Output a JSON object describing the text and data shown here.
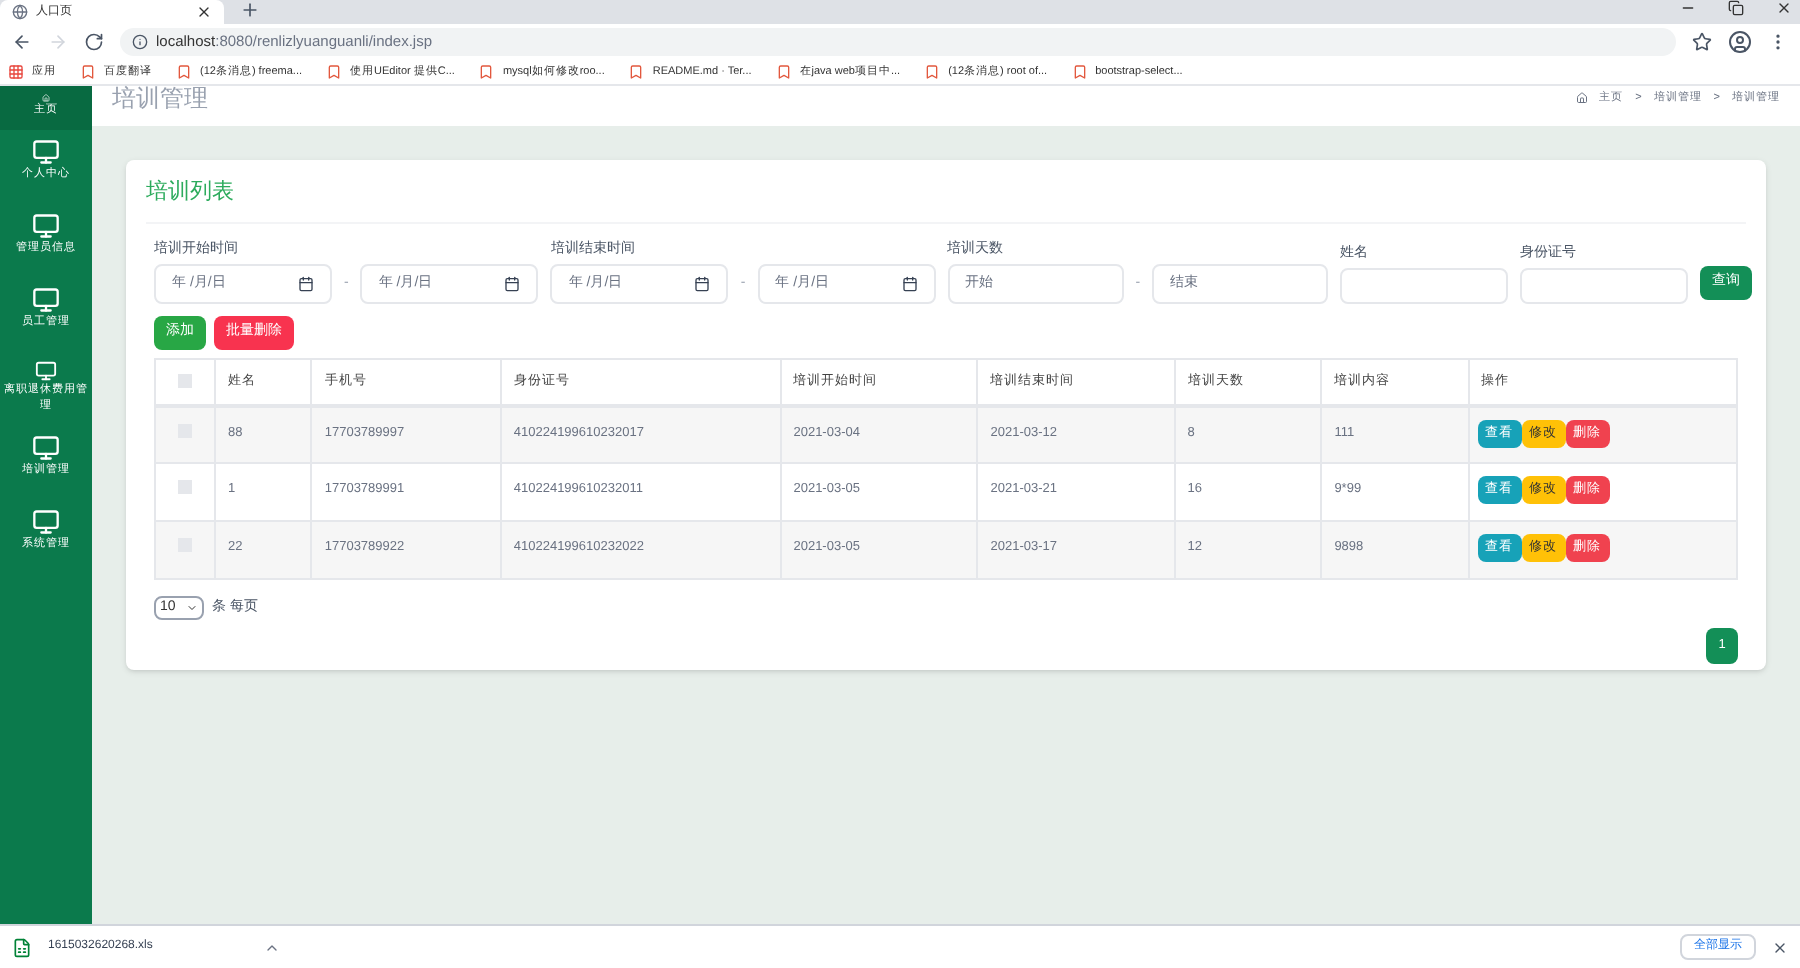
{
  "browser": {
    "tab_title": "人口页",
    "url_host": "localhost",
    "url_rest": ":8080/renlizlyuanguanli/index.jsp",
    "bookmarks": [
      "应用",
      "百度翻译",
      "(12条消息) freema...",
      "使用UEditor 提供C...",
      "mysql如何修改roo...",
      "README.md · Ter...",
      "在java web项目中...",
      "(12条消息) root of...",
      "bootstrap-select..."
    ]
  },
  "sidebar": {
    "items": [
      {
        "label": "主页",
        "selected": true
      },
      {
        "label": "个人中心",
        "selected": false
      },
      {
        "label": "管理员信息",
        "selected": false
      },
      {
        "label": "员工管理",
        "selected": false
      },
      {
        "label": "离职退休费用管理",
        "selected": false
      },
      {
        "label": "培训管理",
        "selected": false
      },
      {
        "label": "系统管理",
        "selected": false
      }
    ]
  },
  "page_title": "培训管理",
  "breadcrumb": [
    "主页",
    "培训管理",
    "培训管理"
  ],
  "breadcrumb_separator": ">",
  "card_title": "培训列表",
  "filters": [
    {
      "label": "培训开始时间",
      "kind": "date",
      "placeholders": [
        "年 /月/日",
        "年 /月/日"
      ],
      "separator": "-"
    },
    {
      "label": "培训结束时间",
      "kind": "date",
      "placeholders": [
        "年 /月/日",
        "年 /月/日"
      ],
      "separator": "-"
    },
    {
      "label": "培训天数",
      "kind": "range",
      "placeholders": [
        "开始",
        "结束"
      ],
      "separator": "-"
    },
    {
      "label": "姓名",
      "kind": "text"
    },
    {
      "label": "身份证号",
      "kind": "text"
    }
  ],
  "search_button": "查询",
  "add_button": "添加",
  "batch_delete_button": "批量删除",
  "table": {
    "columns": [
      "姓名",
      "手机号",
      "身份证号",
      "培训开始时间",
      "培训结束时间",
      "培训天数",
      "培训内容",
      "操作"
    ],
    "select_all_checked": false,
    "rows": [
      {
        "checked": false,
        "cells": [
          "88",
          "17703789997",
          "410224199610232017",
          "2021-03-04",
          "2021-03-12",
          "8",
          "111"
        ],
        "actions": [
          "查看",
          "修改",
          "删除"
        ]
      },
      {
        "checked": false,
        "cells": [
          "1",
          "17703789991",
          "410224199610232011",
          "2021-03-05",
          "2021-03-21",
          "16",
          "9*99"
        ],
        "actions": [
          "查看",
          "修改",
          "删除"
        ]
      },
      {
        "checked": false,
        "cells": [
          "22",
          "17703789922",
          "410224199610232022",
          "2021-03-05",
          "2021-03-17",
          "12",
          "9898"
        ],
        "actions": [
          "查看",
          "修改",
          "删除"
        ]
      }
    ]
  },
  "page_size": "10",
  "page_size_suffix": "条 每页",
  "pages": [
    {
      "label": "1",
      "selected": true
    }
  ],
  "download": {
    "file": "1615032620268.xls",
    "show_all": "全部显示"
  }
}
